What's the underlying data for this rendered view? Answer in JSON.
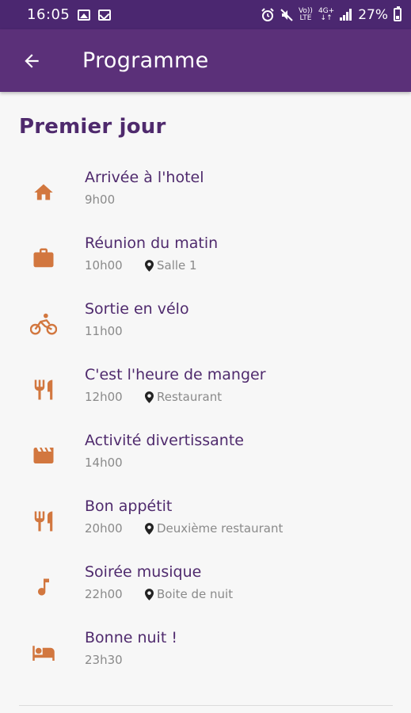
{
  "status_bar": {
    "time": "16:05",
    "battery": "27%",
    "volte_top": "Vo))",
    "volte_bottom": "LTE",
    "network_top": "4G+",
    "network_bottom": "↓↑"
  },
  "app_bar": {
    "title": "Programme"
  },
  "section": {
    "title": "Premier jour"
  },
  "colors": {
    "status_bar": "#4b2770",
    "app_bar": "#5b3079",
    "accent_icon": "#d2773f",
    "title_text": "#4f2a6d",
    "meta_text": "#8a8a8a",
    "background": "#f7f7f7"
  },
  "items": [
    {
      "icon": "home-icon",
      "title": "Arrivée à l'hotel",
      "time": "9h00",
      "location": ""
    },
    {
      "icon": "briefcase-icon",
      "title": "Réunion du matin",
      "time": "10h00",
      "location": "Salle 1"
    },
    {
      "icon": "bike-icon",
      "title": "Sortie en vélo",
      "time": "11h00",
      "location": ""
    },
    {
      "icon": "restaurant-icon",
      "title": "C'est l'heure de manger",
      "time": "12h00",
      "location": "Restaurant"
    },
    {
      "icon": "movie-icon",
      "title": "Activité divertissante",
      "time": "14h00",
      "location": ""
    },
    {
      "icon": "restaurant-icon",
      "title": "Bon appétit",
      "time": "20h00",
      "location": "Deuxième restaurant"
    },
    {
      "icon": "music-note-icon",
      "title": "Soirée musique",
      "time": "22h00",
      "location": "Boite de nuit"
    },
    {
      "icon": "bed-icon",
      "title": "Bonne nuit !",
      "time": "23h30",
      "location": ""
    }
  ]
}
